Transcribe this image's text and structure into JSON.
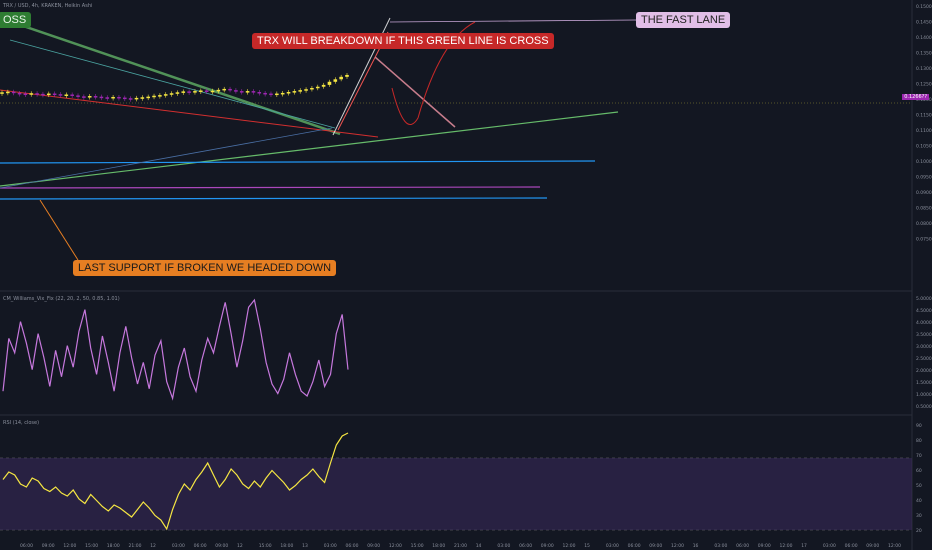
{
  "header": {
    "symbol_line": "TRX / USD, 4h, KRAKEN, Heikin Ashi",
    "indicator1": "CM_Williams_Vix_Fix (22, 20, 2, 50, 0.85, 1.01)",
    "indicator2": "RSI (14, close)"
  },
  "annotations": {
    "cross_tag": "OSS",
    "breakdown": "TRX WILL BREAKDOWN IF THIS GREEN LINE IS CROSS",
    "fast_lane": "THE FAST LANE",
    "support": "LAST SUPPORT IF BROKEN WE HEADED DOWN"
  },
  "colors": {
    "background": "#131722",
    "bull": "#f5e642",
    "bear": "#9c27b0",
    "wvf": "#c678dd",
    "rsi": "#f5e642",
    "rsi_band": "#3a2a5c",
    "green_line": "#66bb6a",
    "red_line": "#d32f2f",
    "blue_line": "#2196f3",
    "purple_line": "#ab47bc"
  },
  "chart_data": [
    {
      "type": "candlestick",
      "title": "TRX / USD, 4h, KRAKEN, Heikin Ashi",
      "price_labels": [
        "0.150000",
        "0.145000",
        "0.140000",
        "0.135000",
        "0.130000",
        "0.125000",
        "0.120000",
        "0.115000",
        "0.110000",
        "0.105000",
        "0.100000",
        "0.095000",
        "0.090000",
        "0.085000",
        "0.080000",
        "0.075000"
      ],
      "current_price": "0.1266??",
      "time_labels": [
        "06:00",
        "09:00",
        "12:00",
        "15:00",
        "18:00",
        "21:00",
        "12",
        "03:00",
        "06:00",
        "09:00",
        "12",
        "15:00",
        "18:00",
        "13",
        "03:00",
        "06:00",
        "09:00",
        "12:00",
        "15:00",
        "18:00",
        "21:00",
        "14",
        "03:00",
        "06:00",
        "09:00",
        "12:00",
        "15",
        "03:00",
        "06:00",
        "09:00",
        "12:00",
        "16",
        "03:00",
        "06:00",
        "09:00",
        "12:00",
        "17",
        "03:00",
        "06:00",
        "09:00",
        "12:00"
      ],
      "price_series": [
        0.1228,
        0.123,
        0.1226,
        0.1224,
        0.1222,
        0.1225,
        0.1223,
        0.1221,
        0.1224,
        0.1222,
        0.1219,
        0.1221,
        0.1218,
        0.1215,
        0.1213,
        0.1216,
        0.1214,
        0.1212,
        0.121,
        0.1213,
        0.1211,
        0.1209,
        0.1207,
        0.121,
        0.1212,
        0.1214,
        0.1217,
        0.1219,
        0.1222,
        0.1225,
        0.1228,
        0.1231,
        0.1229,
        0.1232,
        0.1234,
        0.123,
        0.1233,
        0.1236,
        0.1239,
        0.1235,
        0.1232,
        0.1229,
        0.1232,
        0.1229,
        0.1226,
        0.1224,
        0.1222,
        0.1224,
        0.1226,
        0.1229,
        0.1232,
        0.1235,
        0.1238,
        0.1242,
        0.1246,
        0.1252,
        0.1262,
        0.127,
        0.1278,
        0.1284
      ]
    },
    {
      "type": "line",
      "title": "CM_Williams_Vix_Fix (22, 20, 2, 50, 0.85, 1.01)",
      "y_labels": [
        "5.000000",
        "4.500000",
        "4.000000",
        "3.500000",
        "3.000000",
        "2.500000",
        "2.000000",
        "1.500000",
        "1.000000",
        "0.500000"
      ],
      "values": [
        1.2,
        3.4,
        2.8,
        4.1,
        3.2,
        2.1,
        3.6,
        2.6,
        1.4,
        2.9,
        1.8,
        3.1,
        2.2,
        3.7,
        4.6,
        3.0,
        1.9,
        3.5,
        2.4,
        1.2,
        2.8,
        3.9,
        2.6,
        1.5,
        2.4,
        1.3,
        2.7,
        3.3,
        1.6,
        0.9,
        2.2,
        3.0,
        1.8,
        1.2,
        2.5,
        3.4,
        2.8,
        3.9,
        4.9,
        3.6,
        2.2,
        3.3,
        4.7,
        5.0,
        3.8,
        2.4,
        1.5,
        1.1,
        1.7,
        2.8,
        1.9,
        1.2,
        1.0,
        1.6,
        2.5,
        1.4,
        1.9,
        3.6,
        4.4,
        2.1
      ]
    },
    {
      "type": "line",
      "title": "RSI (14, close)",
      "y_labels": [
        "90",
        "80",
        "70",
        "60",
        "50",
        "40",
        "30",
        "20"
      ],
      "band": [
        30,
        70
      ],
      "values": [
        55,
        60,
        58,
        52,
        50,
        56,
        54,
        49,
        47,
        50,
        46,
        44,
        48,
        42,
        39,
        45,
        41,
        37,
        34,
        38,
        36,
        33,
        30,
        35,
        40,
        36,
        31,
        28,
        22,
        35,
        45,
        52,
        48,
        55,
        60,
        66,
        58,
        50,
        55,
        62,
        58,
        52,
        49,
        54,
        50,
        56,
        61,
        57,
        53,
        48,
        51,
        55,
        58,
        62,
        57,
        53,
        66,
        78,
        84,
        86
      ]
    }
  ]
}
